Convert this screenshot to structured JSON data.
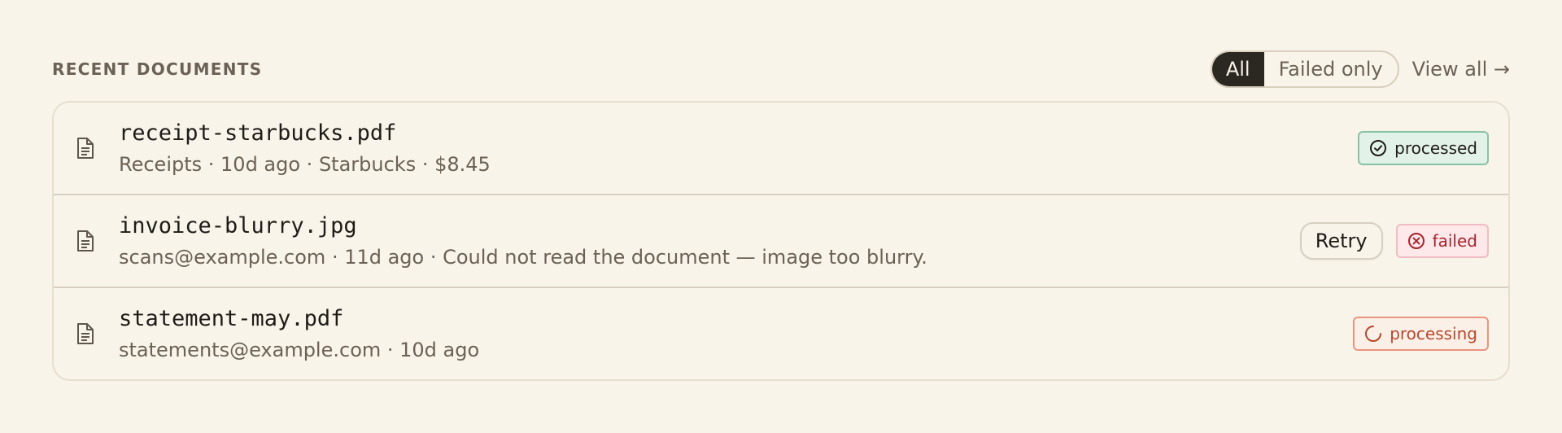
{
  "section": {
    "title": "RECENT DOCUMENTS",
    "filter": {
      "options": [
        "All",
        "Failed only"
      ],
      "selected": "All"
    },
    "view_all_label": "View all →"
  },
  "documents": [
    {
      "name": "receipt-starbucks.pdf",
      "meta": "Receipts · 10d ago · Starbucks · $8.45",
      "status": "processed",
      "status_icon": "check-circle-icon"
    },
    {
      "name": "invoice-blurry.jpg",
      "meta": "scans@example.com · 11d ago · Could not read the document — image too blurry.",
      "action_label": "Retry",
      "status": "failed",
      "status_icon": "x-circle-icon"
    },
    {
      "name": "statement-may.pdf",
      "meta": "statements@example.com · 10d ago",
      "status": "processing",
      "status_icon": "spinner-icon"
    }
  ],
  "colors": {
    "background": "#f8f4ea",
    "active_filter": "#2b2721",
    "processed": "#86c3a5",
    "failed": "#a5232e",
    "processing": "#b7482c"
  }
}
